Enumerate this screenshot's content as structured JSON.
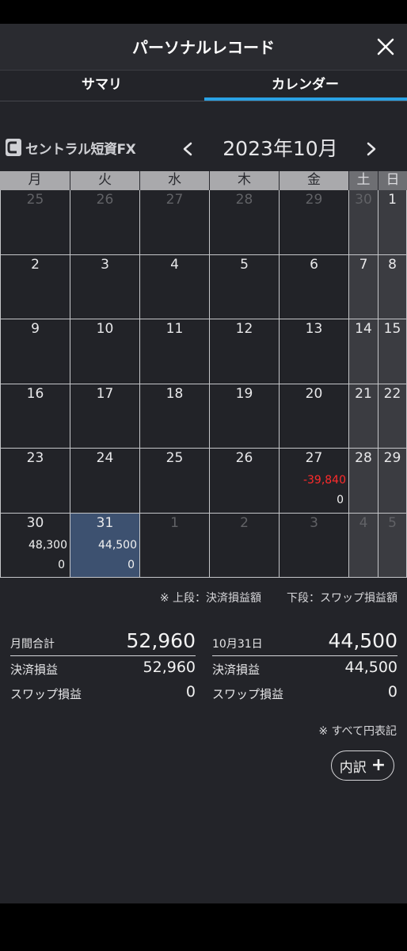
{
  "header": {
    "title": "パーソナルレコード"
  },
  "tabs": [
    {
      "label": "サマリ",
      "active": false
    },
    {
      "label": "カレンダー",
      "active": true
    }
  ],
  "logo": {
    "text": "セントラル短資FX"
  },
  "calendar": {
    "month_label": "2023年10月",
    "weekdays": [
      "月",
      "火",
      "水",
      "木",
      "金",
      "土",
      "日"
    ],
    "weeks": [
      [
        {
          "day": "25",
          "muted": true
        },
        {
          "day": "26",
          "muted": true
        },
        {
          "day": "27",
          "muted": true
        },
        {
          "day": "28",
          "muted": true
        },
        {
          "day": "29",
          "muted": true
        },
        {
          "day": "30",
          "muted": true
        },
        {
          "day": "1"
        }
      ],
      [
        {
          "day": "2"
        },
        {
          "day": "3"
        },
        {
          "day": "4"
        },
        {
          "day": "5"
        },
        {
          "day": "6"
        },
        {
          "day": "7"
        },
        {
          "day": "8"
        }
      ],
      [
        {
          "day": "9"
        },
        {
          "day": "10"
        },
        {
          "day": "11"
        },
        {
          "day": "12"
        },
        {
          "day": "13"
        },
        {
          "day": "14"
        },
        {
          "day": "15"
        }
      ],
      [
        {
          "day": "16"
        },
        {
          "day": "17"
        },
        {
          "day": "18"
        },
        {
          "day": "19"
        },
        {
          "day": "20"
        },
        {
          "day": "21"
        },
        {
          "day": "22"
        }
      ],
      [
        {
          "day": "23"
        },
        {
          "day": "24"
        },
        {
          "day": "25"
        },
        {
          "day": "26"
        },
        {
          "day": "27",
          "settle": "-39,840",
          "swap": "0",
          "negative": true
        },
        {
          "day": "28"
        },
        {
          "day": "29"
        }
      ],
      [
        {
          "day": "30",
          "settle": "48,300",
          "swap": "0"
        },
        {
          "day": "31",
          "settle": "44,500",
          "swap": "0",
          "selected": true
        },
        {
          "day": "1",
          "muted": true
        },
        {
          "day": "2",
          "muted": true
        },
        {
          "day": "3",
          "muted": true
        },
        {
          "day": "4",
          "muted": true
        },
        {
          "day": "5",
          "muted": true
        }
      ]
    ]
  },
  "legend": {
    "upper": "※ 上段：決済損益額",
    "lower": "下段：スワップ損益額"
  },
  "monthly": {
    "title": "月間合計",
    "total": "52,960",
    "settle_label": "決済損益",
    "settle": "52,960",
    "swap_label": "スワップ損益",
    "swap": "0"
  },
  "daily": {
    "title": "10月31日",
    "total": "44,500",
    "settle_label": "決済損益",
    "settle": "44,500",
    "swap_label": "スワップ損益",
    "swap": "0"
  },
  "note": "※ すべて円表記",
  "detail_button": {
    "label": "内訳",
    "icon": "plus-icon"
  },
  "colors": {
    "accent": "#2aa2e4",
    "negative": "#ff2b2b",
    "selected": "#3d5170"
  }
}
